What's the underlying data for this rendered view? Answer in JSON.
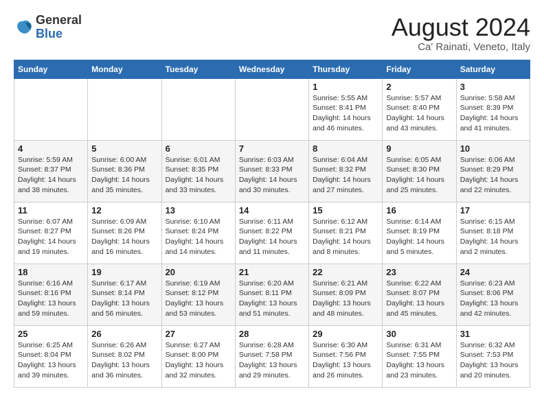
{
  "header": {
    "logo_general": "General",
    "logo_blue": "Blue",
    "month_year": "August 2024",
    "location": "Ca' Rainati, Veneto, Italy"
  },
  "days_of_week": [
    "Sunday",
    "Monday",
    "Tuesday",
    "Wednesday",
    "Thursday",
    "Friday",
    "Saturday"
  ],
  "weeks": [
    [
      {
        "day": "",
        "info": ""
      },
      {
        "day": "",
        "info": ""
      },
      {
        "day": "",
        "info": ""
      },
      {
        "day": "",
        "info": ""
      },
      {
        "day": "1",
        "info": "Sunrise: 5:55 AM\nSunset: 8:41 PM\nDaylight: 14 hours\nand 46 minutes."
      },
      {
        "day": "2",
        "info": "Sunrise: 5:57 AM\nSunset: 8:40 PM\nDaylight: 14 hours\nand 43 minutes."
      },
      {
        "day": "3",
        "info": "Sunrise: 5:58 AM\nSunset: 8:39 PM\nDaylight: 14 hours\nand 41 minutes."
      }
    ],
    [
      {
        "day": "4",
        "info": "Sunrise: 5:59 AM\nSunset: 8:37 PM\nDaylight: 14 hours\nand 38 minutes."
      },
      {
        "day": "5",
        "info": "Sunrise: 6:00 AM\nSunset: 8:36 PM\nDaylight: 14 hours\nand 35 minutes."
      },
      {
        "day": "6",
        "info": "Sunrise: 6:01 AM\nSunset: 8:35 PM\nDaylight: 14 hours\nand 33 minutes."
      },
      {
        "day": "7",
        "info": "Sunrise: 6:03 AM\nSunset: 8:33 PM\nDaylight: 14 hours\nand 30 minutes."
      },
      {
        "day": "8",
        "info": "Sunrise: 6:04 AM\nSunset: 8:32 PM\nDaylight: 14 hours\nand 27 minutes."
      },
      {
        "day": "9",
        "info": "Sunrise: 6:05 AM\nSunset: 8:30 PM\nDaylight: 14 hours\nand 25 minutes."
      },
      {
        "day": "10",
        "info": "Sunrise: 6:06 AM\nSunset: 8:29 PM\nDaylight: 14 hours\nand 22 minutes."
      }
    ],
    [
      {
        "day": "11",
        "info": "Sunrise: 6:07 AM\nSunset: 8:27 PM\nDaylight: 14 hours\nand 19 minutes."
      },
      {
        "day": "12",
        "info": "Sunrise: 6:09 AM\nSunset: 8:26 PM\nDaylight: 14 hours\nand 16 minutes."
      },
      {
        "day": "13",
        "info": "Sunrise: 6:10 AM\nSunset: 8:24 PM\nDaylight: 14 hours\nand 14 minutes."
      },
      {
        "day": "14",
        "info": "Sunrise: 6:11 AM\nSunset: 8:22 PM\nDaylight: 14 hours\nand 11 minutes."
      },
      {
        "day": "15",
        "info": "Sunrise: 6:12 AM\nSunset: 8:21 PM\nDaylight: 14 hours\nand 8 minutes."
      },
      {
        "day": "16",
        "info": "Sunrise: 6:14 AM\nSunset: 8:19 PM\nDaylight: 14 hours\nand 5 minutes."
      },
      {
        "day": "17",
        "info": "Sunrise: 6:15 AM\nSunset: 8:18 PM\nDaylight: 14 hours\nand 2 minutes."
      }
    ],
    [
      {
        "day": "18",
        "info": "Sunrise: 6:16 AM\nSunset: 8:16 PM\nDaylight: 13 hours\nand 59 minutes."
      },
      {
        "day": "19",
        "info": "Sunrise: 6:17 AM\nSunset: 8:14 PM\nDaylight: 13 hours\nand 56 minutes."
      },
      {
        "day": "20",
        "info": "Sunrise: 6:19 AM\nSunset: 8:12 PM\nDaylight: 13 hours\nand 53 minutes."
      },
      {
        "day": "21",
        "info": "Sunrise: 6:20 AM\nSunset: 8:11 PM\nDaylight: 13 hours\nand 51 minutes."
      },
      {
        "day": "22",
        "info": "Sunrise: 6:21 AM\nSunset: 8:09 PM\nDaylight: 13 hours\nand 48 minutes."
      },
      {
        "day": "23",
        "info": "Sunrise: 6:22 AM\nSunset: 8:07 PM\nDaylight: 13 hours\nand 45 minutes."
      },
      {
        "day": "24",
        "info": "Sunrise: 6:23 AM\nSunset: 8:06 PM\nDaylight: 13 hours\nand 42 minutes."
      }
    ],
    [
      {
        "day": "25",
        "info": "Sunrise: 6:25 AM\nSunset: 8:04 PM\nDaylight: 13 hours\nand 39 minutes."
      },
      {
        "day": "26",
        "info": "Sunrise: 6:26 AM\nSunset: 8:02 PM\nDaylight: 13 hours\nand 36 minutes."
      },
      {
        "day": "27",
        "info": "Sunrise: 6:27 AM\nSunset: 8:00 PM\nDaylight: 13 hours\nand 32 minutes."
      },
      {
        "day": "28",
        "info": "Sunrise: 6:28 AM\nSunset: 7:58 PM\nDaylight: 13 hours\nand 29 minutes."
      },
      {
        "day": "29",
        "info": "Sunrise: 6:30 AM\nSunset: 7:56 PM\nDaylight: 13 hours\nand 26 minutes."
      },
      {
        "day": "30",
        "info": "Sunrise: 6:31 AM\nSunset: 7:55 PM\nDaylight: 13 hours\nand 23 minutes."
      },
      {
        "day": "31",
        "info": "Sunrise: 6:32 AM\nSunset: 7:53 PM\nDaylight: 13 hours\nand 20 minutes."
      }
    ]
  ]
}
